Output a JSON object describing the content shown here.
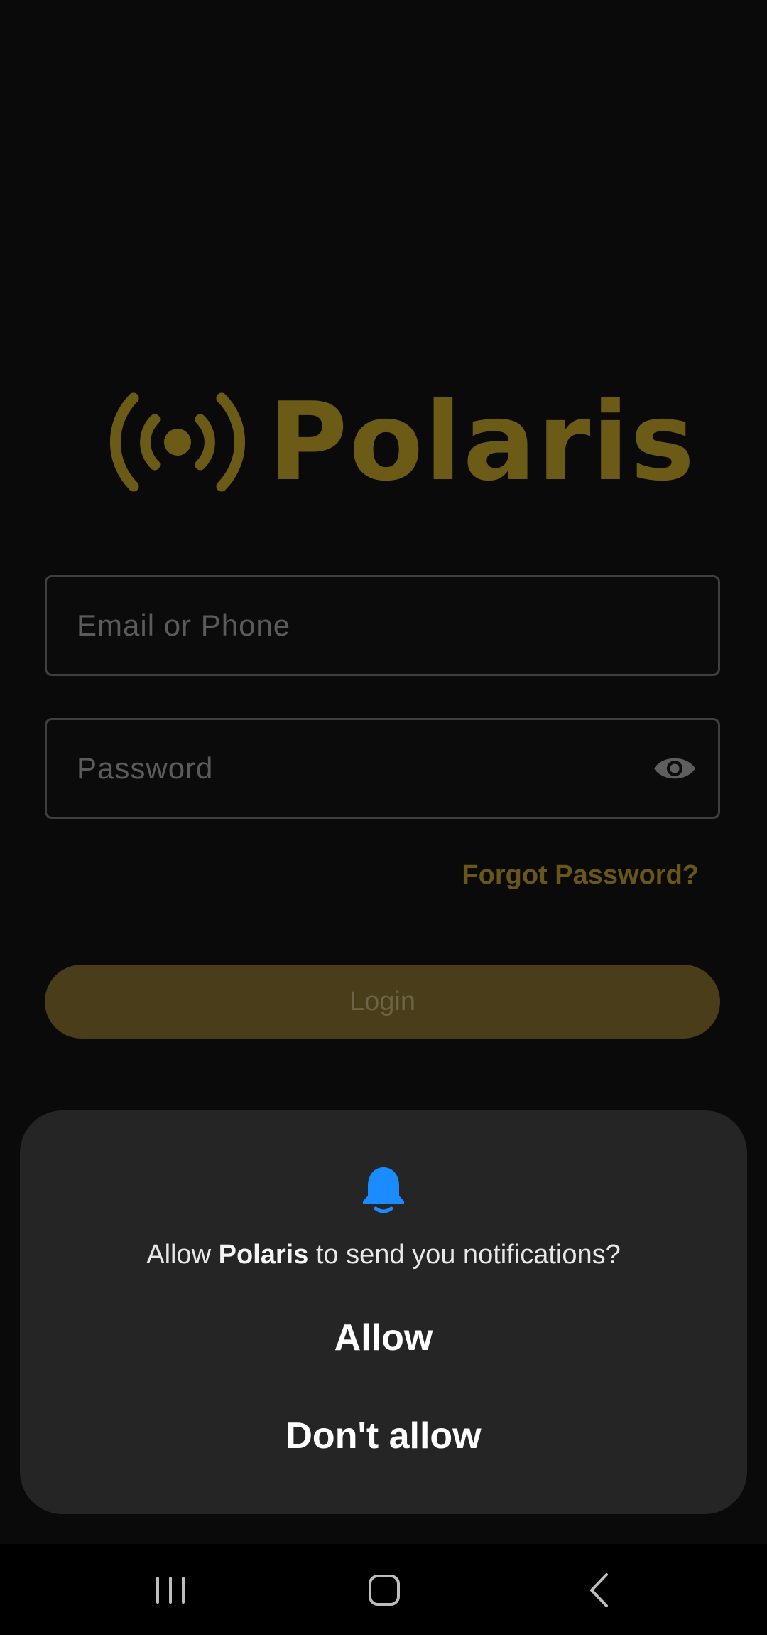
{
  "app": {
    "name": "Polaris",
    "colors": {
      "brand": "#6c5b16",
      "background": "#0a0a0a",
      "login_button": "#4a3d19"
    }
  },
  "login": {
    "email_placeholder": "Email or Phone",
    "password_placeholder": "Password",
    "forgot_password": "Forgot Password?",
    "login_button": "Login"
  },
  "dialog": {
    "icon": "bell-icon",
    "message_prefix": "Allow ",
    "message_app": "Polaris",
    "message_suffix": " to send you notifications?",
    "allow_button": "Allow",
    "deny_button": "Don't allow",
    "accent": "#1a8cff"
  },
  "navbar": {
    "icons": [
      "recent-apps-icon",
      "home-icon",
      "back-icon"
    ]
  }
}
